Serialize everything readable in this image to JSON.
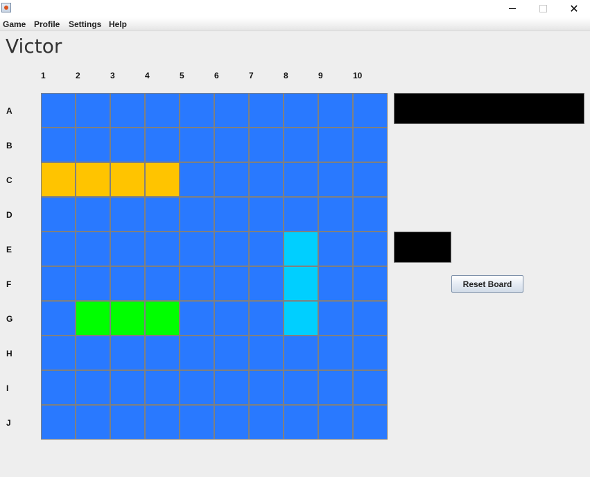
{
  "window": {
    "app_icon": "java-cup-icon",
    "controls": {
      "minimize_glyph": "",
      "maximize_glyph": "",
      "close_glyph": "✕"
    }
  },
  "menu": {
    "items": [
      "Game",
      "Profile",
      "Settings",
      "Help"
    ]
  },
  "player": {
    "name": "Victor"
  },
  "board": {
    "columns": [
      "1",
      "2",
      "3",
      "4",
      "5",
      "6",
      "7",
      "8",
      "9",
      "10"
    ],
    "rows": [
      "A",
      "B",
      "C",
      "D",
      "E",
      "F",
      "G",
      "H",
      "I",
      "J"
    ],
    "colors": {
      "water": "#2979ff",
      "ship_yellow": "#ffc400",
      "ship_green": "#00ff00",
      "ship_cyan": "#00cfff",
      "grid_line": "#808080"
    },
    "ships": [
      {
        "color": "yellow",
        "cells": [
          "C1",
          "C2",
          "C3",
          "C4"
        ]
      },
      {
        "color": "green",
        "cells": [
          "G2",
          "G3",
          "G4"
        ]
      },
      {
        "color": "cyan",
        "cells": [
          "E8",
          "F8",
          "G8"
        ]
      }
    ]
  },
  "side_panel": {
    "reset_label": "Reset Board"
  }
}
